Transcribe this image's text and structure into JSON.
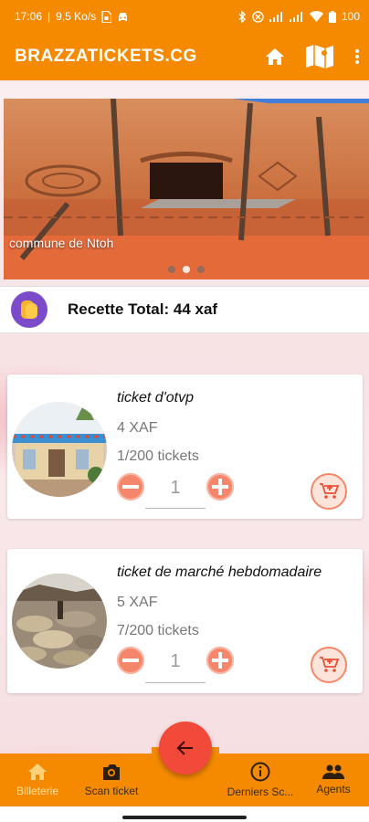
{
  "status_bar": {
    "time": "17:06",
    "network_speed": "9,5 Ko/s",
    "battery": "100",
    "icons": [
      "sim-icon",
      "car-icon",
      "bluetooth-icon",
      "vpn-icon",
      "signal-icon",
      "signal-icon",
      "wifi-icon",
      "battery-icon"
    ]
  },
  "app_bar": {
    "title": "BRAZZATICKETS.CG",
    "actions": [
      "home-icon",
      "map-icon",
      "more-vert-icon"
    ]
  },
  "carousel": {
    "caption": "commune de Ntoh",
    "slide_count": 3,
    "active_slide": 2
  },
  "total": {
    "label": "Recette Total: 44 xaf"
  },
  "tickets": [
    {
      "name": "ticket d'otvp",
      "price": "4 XAF",
      "stock": "1/200 tickets",
      "quantity": "1"
    },
    {
      "name": "ticket de marché hebdomadaire",
      "price": "5 XAF",
      "stock": "7/200 tickets",
      "quantity": "1"
    }
  ],
  "bottom_nav": {
    "items": [
      {
        "label": "Billeterie",
        "icon": "home-icon",
        "active": true
      },
      {
        "label": "Scan ticket",
        "icon": "camera-icon",
        "active": false
      },
      {
        "label": "Derniers Sc...",
        "icon": "info-icon",
        "active": false
      },
      {
        "label": "Agents",
        "icon": "people-icon",
        "active": false
      }
    ],
    "fab_icon": "arrow-back-icon"
  },
  "colors": {
    "primary": "#f58a00",
    "fab": "#f24a3a",
    "accent": "#f4876b",
    "total_icon_bg": "#7c4bc9"
  }
}
